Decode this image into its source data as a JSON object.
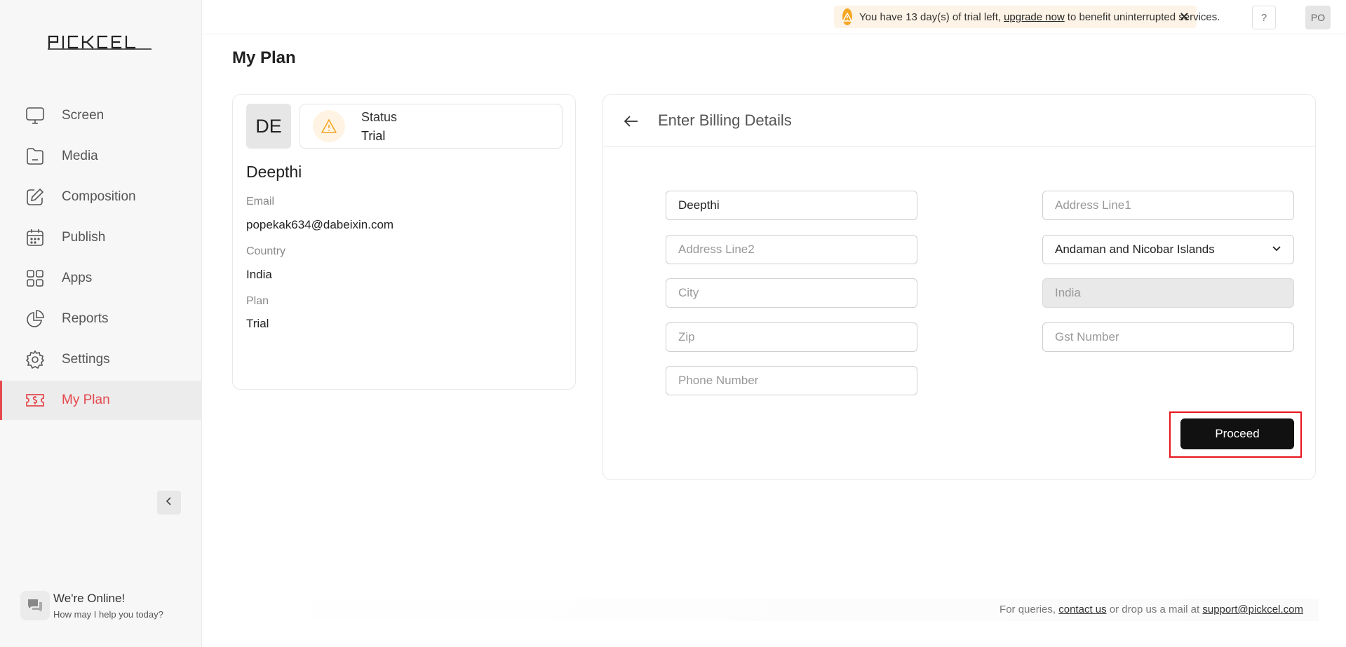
{
  "brand": {
    "logo_text": "PICKCEL"
  },
  "sidebar": {
    "items": [
      {
        "label": "Screen",
        "icon": "monitor-icon",
        "active": false
      },
      {
        "label": "Media",
        "icon": "folder-icon",
        "active": false
      },
      {
        "label": "Composition",
        "icon": "edit-icon",
        "active": false
      },
      {
        "label": "Publish",
        "icon": "calendar-icon",
        "active": false
      },
      {
        "label": "Apps",
        "icon": "apps-grid-icon",
        "active": false
      },
      {
        "label": "Reports",
        "icon": "pie-chart-icon",
        "active": false
      },
      {
        "label": "Settings",
        "icon": "gear-icon",
        "active": false
      },
      {
        "label": "My Plan",
        "icon": "ticket-dollar-icon",
        "active": true
      }
    ],
    "accent_color": "#e5484d"
  },
  "chat_widget": {
    "title": "We're Online!",
    "subtitle": "How may I help you today?"
  },
  "topbar": {
    "trial_text_before": "You have 13 day(s) of trial left,",
    "trial_link": "upgrade now",
    "trial_text_after": "to benefit uninterrupted services.",
    "close_glyph": "✕",
    "help_label": "?",
    "user_initials": "PO"
  },
  "page": {
    "title": "My Plan"
  },
  "profile": {
    "initials": "DE",
    "status_label": "Status",
    "status_value": "Trial",
    "name": "Deepthi",
    "email_label": "Email",
    "email_value": "popekak634@dabeixin.com",
    "country_label": "Country",
    "country_value": "India",
    "plan_label": "Plan",
    "plan_value": "Trial"
  },
  "billing": {
    "title": "Enter Billing Details",
    "name_value": "Deepthi",
    "address1_placeholder": "Address Line1",
    "address2_placeholder": "Address Line2",
    "state_selected": "Andaman and Nicobar Islands",
    "city_placeholder": "City",
    "country_value": "India",
    "zip_placeholder": "Zip",
    "gst_placeholder": "Gst Number",
    "phone_placeholder": "Phone Number",
    "proceed_label": "Proceed"
  },
  "footer": {
    "text_before": "For queries,",
    "contact_link": "contact us",
    "text_middle": "or drop us a mail at",
    "email_link": "support@pickcel.com"
  }
}
